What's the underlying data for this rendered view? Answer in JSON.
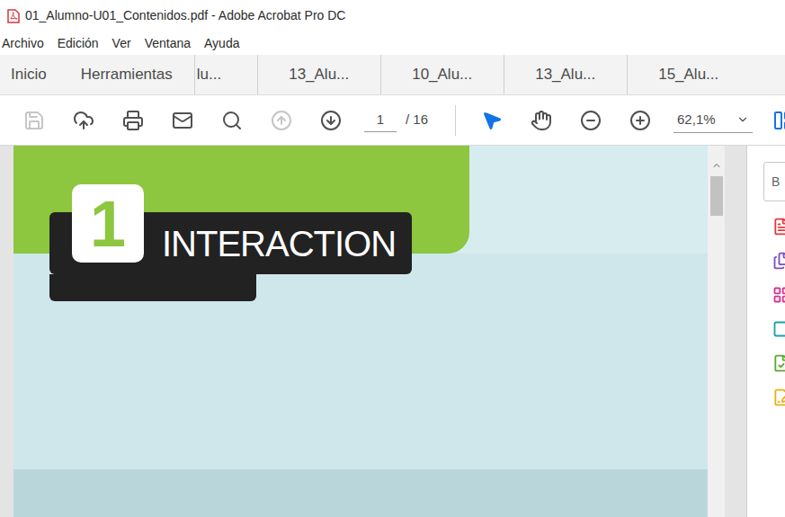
{
  "window": {
    "title": "01_Alumno-U01_Contenidos.pdf - Adobe Acrobat Pro DC"
  },
  "menu": [
    "Archivo",
    "Edición",
    "Ver",
    "Ventana",
    "Ayuda"
  ],
  "nav": [
    "Inicio",
    "Herramientas"
  ],
  "tabs": [
    {
      "label": "lu...",
      "selected": false
    },
    {
      "label": "13_Alu...",
      "selected": false
    },
    {
      "label": "10_Alu...",
      "selected": false
    },
    {
      "label": "13_Alu...",
      "selected": false
    },
    {
      "label": "15_Alu...",
      "selected": false
    }
  ],
  "toolbar": {
    "buttons": [
      {
        "disabled": true
      },
      {
        "disabled": false
      },
      {
        "disabled": false
      },
      {
        "disabled": false
      },
      {
        "disabled": false
      },
      {
        "disabled": true
      },
      {
        "disabled": false
      }
    ],
    "page": {
      "current": "1",
      "total": "/ 16"
    },
    "tools": [
      {
        "selected": true
      },
      {
        "selected": false
      },
      {
        "selected": false
      },
      {
        "selected": false
      }
    ],
    "zoom": "62,1%"
  },
  "document": {
    "chapter": "1",
    "title": "INTERACTION"
  },
  "right_panel": {
    "search": "B",
    "tools": [
      {
        "color": "#e03a3e"
      },
      {
        "color": "#7b4fc6"
      },
      {
        "color": "#d6338f"
      },
      {
        "color": "#1ba1a8"
      },
      {
        "color": "#5aa832"
      },
      {
        "color": "#e8b311"
      }
    ]
  }
}
